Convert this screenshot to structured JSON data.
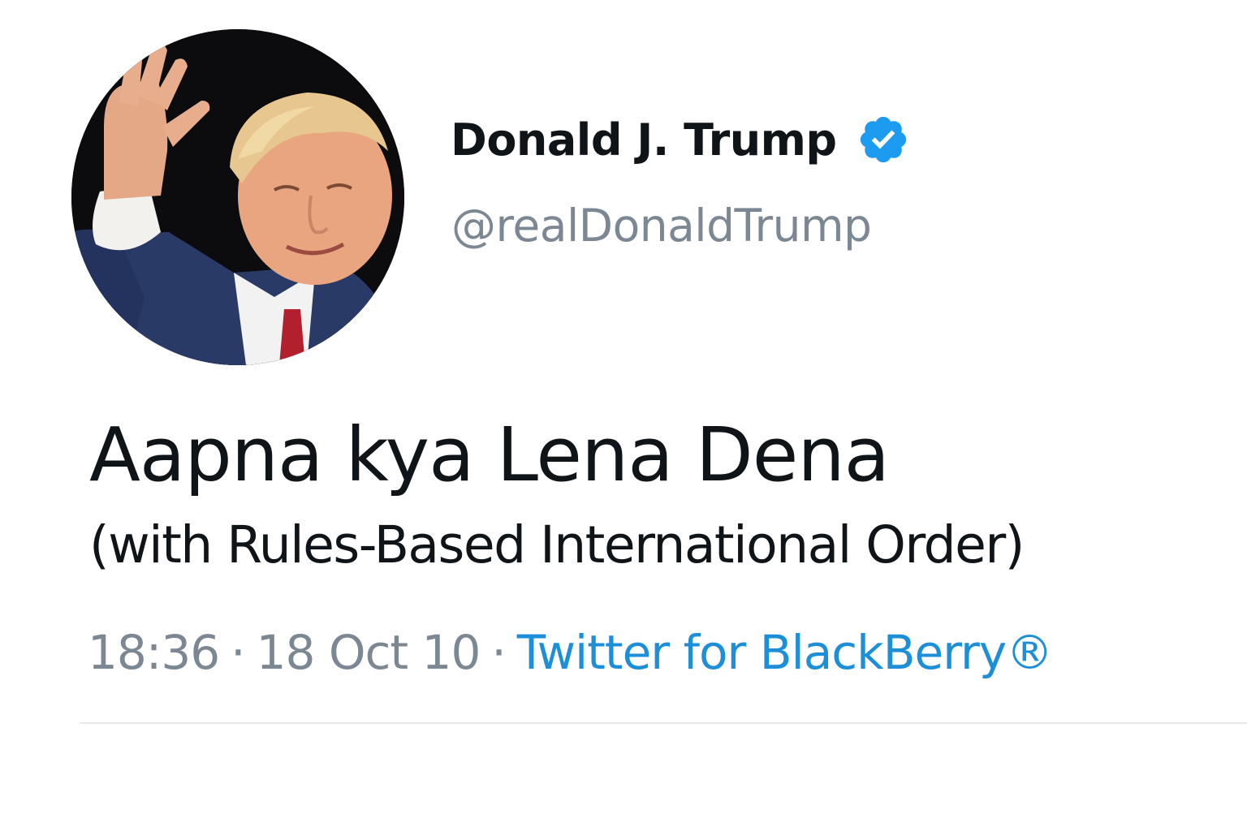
{
  "author": {
    "display_name": "Donald J. Trump",
    "handle": "@realDonaldTrump",
    "verified_icon": "verified-badge-icon",
    "verified_color": "#1d9bf0"
  },
  "tweet": {
    "line1": "Aapna kya Lena Dena",
    "line2": "(with Rules-Based International Order)"
  },
  "meta": {
    "time": "18:36",
    "separator": "·",
    "date": "18 Oct 10",
    "source": "Twitter for BlackBerry®"
  },
  "colors": {
    "text_primary": "#0f1419",
    "text_secondary": "#7b8893",
    "link": "#1d8fd8",
    "divider": "#e6e8ea"
  }
}
